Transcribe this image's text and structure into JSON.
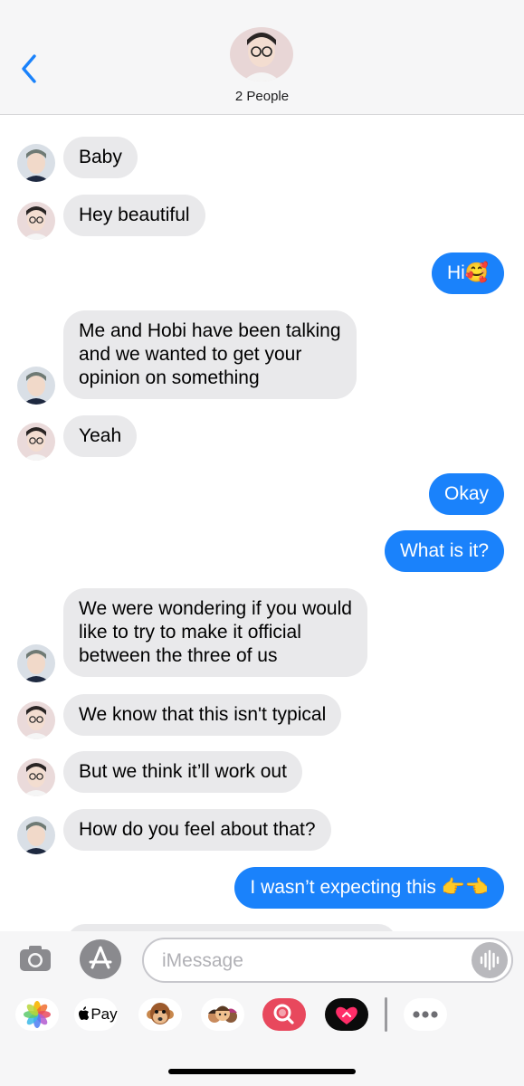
{
  "header": {
    "group_label": "2 People"
  },
  "messages": [
    {
      "text": "Baby",
      "side": "in",
      "avatar": "person-b"
    },
    {
      "text": "Hey beautiful",
      "side": "in",
      "avatar": "person-a"
    },
    {
      "text": "Hi🥰",
      "side": "out"
    },
    {
      "text": "Me and Hobi have been talking\nand we wanted to get your\nopinion on something",
      "side": "in",
      "avatar": "person-b"
    },
    {
      "text": "Yeah",
      "side": "in",
      "avatar": "person-a"
    },
    {
      "text": "Okay",
      "side": "out"
    },
    {
      "text": "What is it?",
      "side": "out"
    },
    {
      "text": "We were wondering if you would\nlike to try to make it official\nbetween the three of us",
      "side": "in",
      "avatar": "person-b"
    },
    {
      "text": "We know that this isn't typical",
      "side": "in",
      "avatar": "person-a"
    },
    {
      "text": "But we think it’ll work out",
      "side": "in",
      "avatar": "person-a"
    },
    {
      "text": "How do you feel about that?",
      "side": "in",
      "avatar": "person-b"
    },
    {
      "text": "I wasn’t expecting this 👉👈",
      "side": "out"
    }
  ],
  "composer": {
    "placeholder": "iMessage"
  },
  "apps": {
    "pay_label": "Pay",
    "items": [
      "photos-icon",
      "apple-pay-icon",
      "animoji-icon",
      "memoji-icon",
      "image-search-icon",
      "fitness-icon",
      "more-icon"
    ]
  },
  "colors": {
    "outgoing": "#1a82fb",
    "incoming": "#e9e9eb",
    "accent": "#1a82fb"
  }
}
